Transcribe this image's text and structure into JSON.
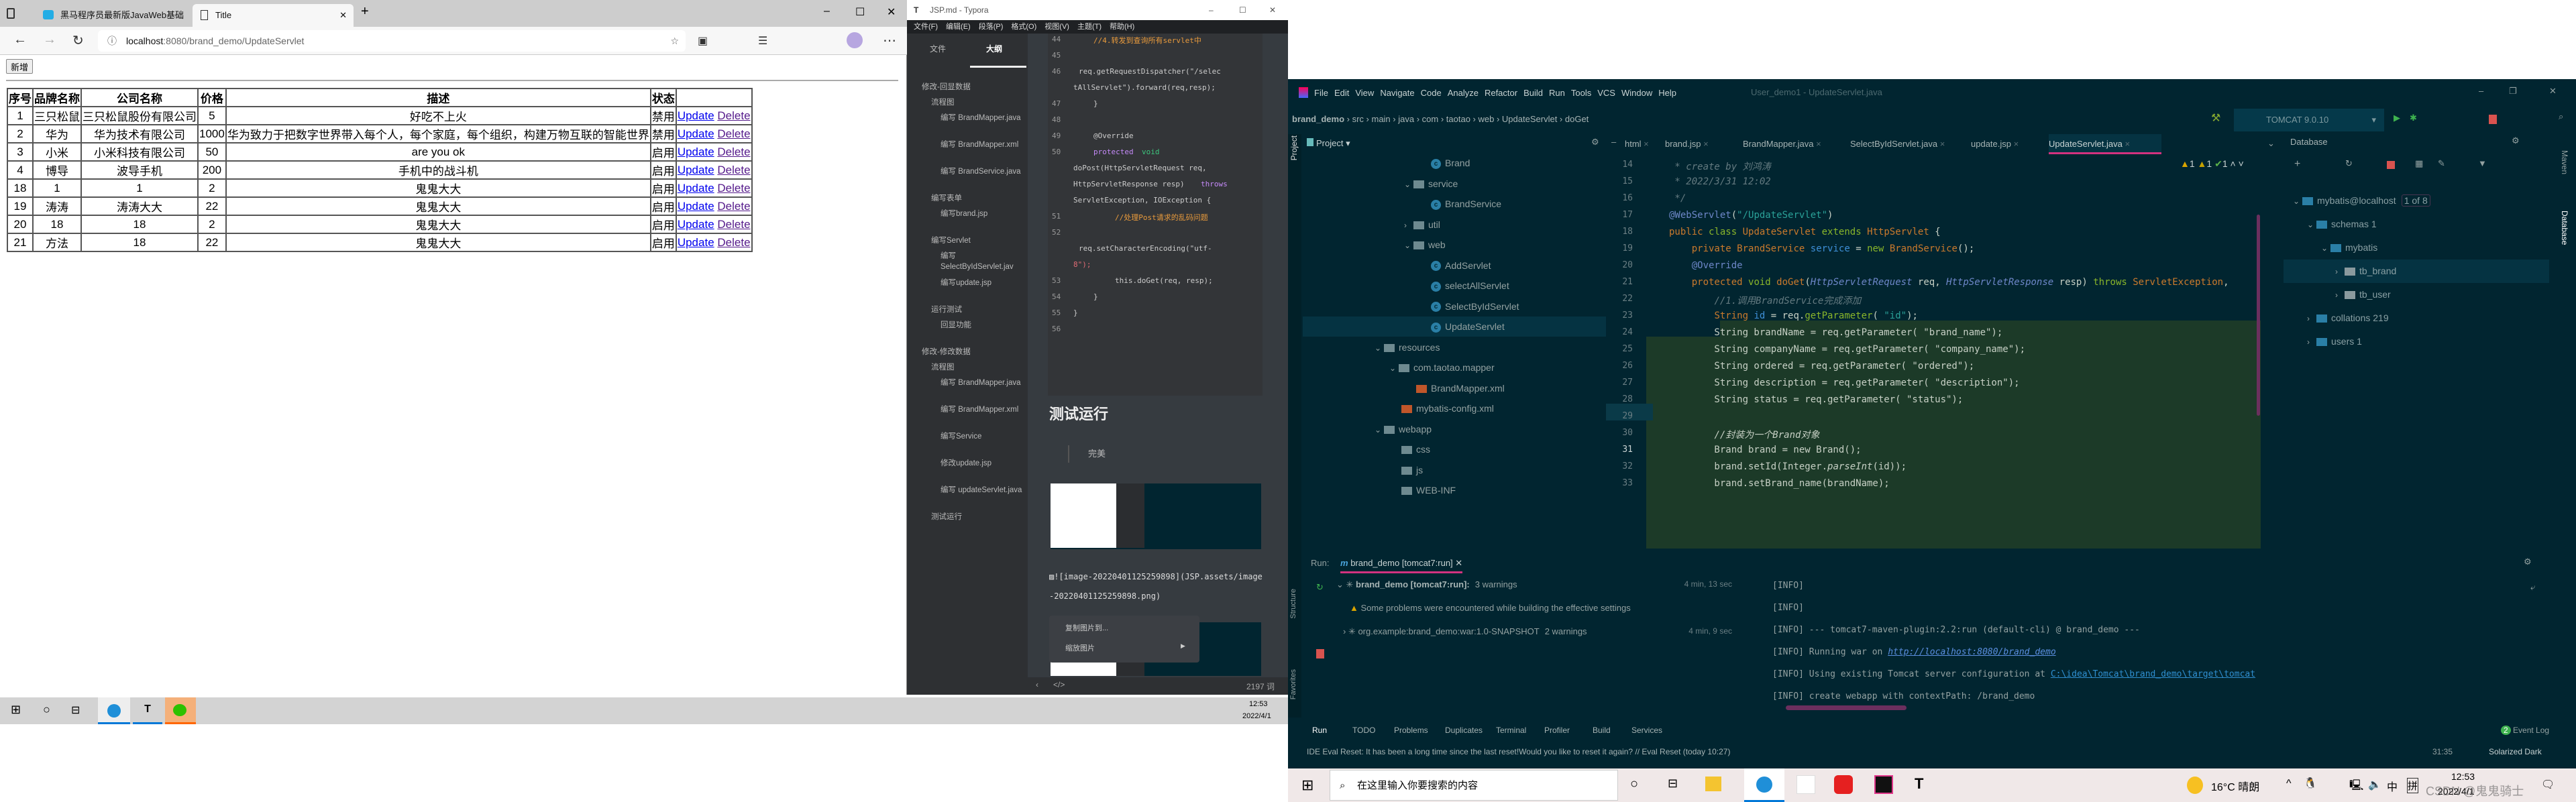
{
  "browser": {
    "tabs": [
      {
        "label": "黑马程序员最新版JavaWeb基础"
      },
      {
        "label": "Title"
      }
    ],
    "url_host": "localhost",
    "url_path": ":8080/brand_demo/UpdateServlet",
    "new_button": "新增",
    "table": {
      "headers": [
        "序号",
        "品牌名称",
        "公司名称",
        "价格",
        "描述",
        "状态",
        ""
      ],
      "rows": [
        [
          "1",
          "三只松鼠",
          "三只松鼠股份有限公司",
          "5",
          "好吃不上火",
          "禁用"
        ],
        [
          "2",
          "华为",
          "华为技术有限公司",
          "1000",
          "华为致力于把数字世界带入每个人，每个家庭，每个组织，构建万物互联的智能世界",
          "禁用"
        ],
        [
          "3",
          "小米",
          "小米科技有限公司",
          "50",
          "are you ok",
          "启用"
        ],
        [
          "4",
          "博导",
          "波导手机",
          "200",
          "手机中的战斗机",
          "启用"
        ],
        [
          "18",
          "1",
          "1",
          "2",
          "鬼鬼大大",
          "启用"
        ],
        [
          "19",
          "涛涛",
          "涛涛大大",
          "22",
          "鬼鬼大大",
          "启用"
        ],
        [
          "20",
          "18",
          "18",
          "2",
          "鬼鬼大大",
          "启用"
        ],
        [
          "21",
          "方法",
          "18",
          "22",
          "鬼鬼大大",
          "启用"
        ]
      ],
      "update_link": "Update",
      "delete_link": "Delete"
    }
  },
  "typora": {
    "title": "JSP.md - Typora",
    "menu": [
      "文件(F)",
      "编辑(E)",
      "段落(P)",
      "格式(O)",
      "视图(V)",
      "主题(T)",
      "帮助(H)"
    ],
    "side_tabs": [
      "文件",
      "大纲"
    ],
    "outline": [
      {
        "t": "修改-回显数据",
        "l": 0
      },
      {
        "t": "流程图",
        "l": 1
      },
      {
        "t": "编写 BrandMapper.java",
        "l": 2
      },
      {
        "t": "编写 BrandMapper.xml",
        "l": 2
      },
      {
        "t": "编写 BrandService.java",
        "l": 2
      },
      {
        "t": "编写表单",
        "l": 1
      },
      {
        "t": "编写brand.jsp",
        "l": 2
      },
      {
        "t": "编写Servlet",
        "l": 1
      },
      {
        "t": "编写 SelectByIdServlet.jav",
        "l": 2
      },
      {
        "t": "编写update.jsp",
        "l": 2
      },
      {
        "t": "运行测试",
        "l": 1
      },
      {
        "t": "回显功能",
        "l": 2
      },
      {
        "t": "修改-修改数据",
        "l": 0
      },
      {
        "t": "流程图",
        "l": 1
      },
      {
        "t": "编写 BrandMapper.java",
        "l": 2
      },
      {
        "t": "编写 BrandMapper.xml",
        "l": 2
      },
      {
        "t": "编写Service",
        "l": 2
      },
      {
        "t": "修改update.jsp",
        "l": 2
      },
      {
        "t": "编写 updateServlet.java",
        "l": 2
      },
      {
        "t": "测试运行",
        "l": 1
      }
    ],
    "code_lines": [
      "44",
      "45",
      "46",
      "",
      "47",
      "48",
      "49",
      "50",
      "",
      "",
      "",
      "51",
      "52",
      "",
      "",
      "53",
      "54",
      "55",
      "56"
    ],
    "code": {
      "c45": "//4.转发到查询所有servlet中",
      "c46a": "req.getRequestDispatcher(\"/selec",
      "c46b": "tAllServlet\").forward(req,resp);",
      "c47": "}",
      "c49": "@Override",
      "c50a": "protected",
      "c50b": "void",
      "c50c": "doPost(HttpServletRequest req,",
      "c50d": "HttpServletResponse resp)",
      "c50e": "throws",
      "c50f": "ServletException, IOException {",
      "c51": "//处理Post请求的乱码问题",
      "c52a": "req.setCharacterEncoding(\"utf-",
      "c52b": "8\");",
      "c53": "this.doGet(req, resp);",
      "c54": "}",
      "c55": "}"
    },
    "heading": "测试运行",
    "quote": "完美",
    "md_text": "![image-20220401125259898](JSP.assets/image-20220401125259898.png)",
    "context_menu": [
      "复制图片到...",
      "缩放图片"
    ],
    "word_count": "2197 词"
  },
  "taskbar_left": {
    "time": "12:53",
    "date": "2022/4/1"
  },
  "idea": {
    "menu": [
      "File",
      "Edit",
      "View",
      "Navigate",
      "Code",
      "Analyze",
      "Refactor",
      "Build",
      "Run",
      "Tools",
      "VCS",
      "Window",
      "Help"
    ],
    "window_title": "User_demo1 - UpdateServlet.java",
    "breadcrumb": [
      "brand_demo",
      "src",
      "main",
      "java",
      "com",
      "taotao",
      "web",
      "UpdateServlet",
      "doGet"
    ],
    "run_config": "TOMCAT 9.0.10",
    "project_label": "Project",
    "editor_tabs": [
      "html",
      "brand.jsp",
      "BrandMapper.java",
      "SelectByIdServlet.java",
      "update.jsp",
      "UpdateServlet.java"
    ],
    "tree": [
      {
        "t": "Brand",
        "i": "class",
        "d": 4
      },
      {
        "t": "service",
        "i": "folder",
        "d": 3,
        "c": "v"
      },
      {
        "t": "BrandService",
        "i": "class",
        "d": 4
      },
      {
        "t": "util",
        "i": "folder",
        "d": 3,
        "c": ">"
      },
      {
        "t": "web",
        "i": "folder",
        "d": 3,
        "c": "v"
      },
      {
        "t": "AddServlet",
        "i": "class",
        "d": 4
      },
      {
        "t": "selectAllServlet",
        "i": "class",
        "d": 4
      },
      {
        "t": "SelectByIdServlet",
        "i": "class",
        "d": 4
      },
      {
        "t": "UpdateServlet",
        "i": "class",
        "d": 4,
        "sel": true
      },
      {
        "t": "resources",
        "i": "folder",
        "d": 1,
        "c": "v"
      },
      {
        "t": "com.taotao.mapper",
        "i": "folder",
        "d": 2,
        "c": "v"
      },
      {
        "t": "BrandMapper.xml",
        "i": "xml",
        "d": 3
      },
      {
        "t": "mybatis-config.xml",
        "i": "xml",
        "d": 2
      },
      {
        "t": "webapp",
        "i": "folder",
        "d": 1,
        "c": "v"
      },
      {
        "t": "css",
        "i": "folder",
        "d": 2
      },
      {
        "t": "js",
        "i": "folder",
        "d": 2
      },
      {
        "t": "WEB-INF",
        "i": "folder",
        "d": 2
      }
    ],
    "inspections": {
      "warnings": "1",
      "weak": "1",
      "ok": "1"
    },
    "line_numbers": [
      "14",
      "15",
      "16",
      "17",
      "18",
      "19",
      "20",
      "21",
      "22",
      "23",
      "24",
      "25",
      "26",
      "27",
      "28",
      "29",
      "30",
      "31",
      "32",
      "33"
    ],
    "database": {
      "title": "Database",
      "items": [
        {
          "t": "mybatis@localhost",
          "badge": "1 of 8",
          "d": 0,
          "c": "v"
        },
        {
          "t": "schemas  1",
          "d": 1,
          "c": "v"
        },
        {
          "t": "mybatis",
          "d": 2,
          "c": "v"
        },
        {
          "t": "tb_brand",
          "d": 3,
          "c": ">",
          "sel": true
        },
        {
          "t": "tb_user",
          "d": 3,
          "c": ">"
        },
        {
          "t": "collations  219",
          "d": 1,
          "c": ">"
        },
        {
          "t": "users  1",
          "d": 1,
          "c": ">"
        }
      ]
    },
    "side_labels": [
      "Maven",
      "Database",
      "Structure",
      "Favorites"
    ],
    "run": {
      "label": "Run:",
      "tab": "brand_demo [tomcat7:run]",
      "tree": [
        {
          "t": "brand_demo [tomcat7:run]:",
          "w": "3 warnings",
          "time": "4 min, 13 sec"
        },
        {
          "t": "Some problems were encountered while building the effective settings"
        },
        {
          "t": "org.example:brand_demo:war:1.0-SNAPSHOT",
          "w": "2 warnings",
          "time": "4 min, 9 sec"
        }
      ],
      "console": [
        "[INFO]",
        "[INFO]",
        "[INFO] --- tomcat7-maven-plugin:2.2:run (default-cli) @ brand_demo ---",
        "[INFO] Running war on ",
        "[INFO] Using existing Tomcat server configuration at ",
        "[INFO] create webapp with contextPath: /brand_demo"
      ],
      "console_link1": "http://localhost:8080/brand_demo",
      "console_link2": "C:\\idea\\Tomcat\\brand_demo\\target\\tomcat"
    },
    "bottom_tools": [
      "Run",
      "TODO",
      "Problems",
      "Duplicates",
      "Terminal",
      "Profiler",
      "Build",
      "Services"
    ],
    "event_log": "Event Log",
    "event_count": "2",
    "status": "IDE Eval Reset: It has been a long time since the last reset!Would you like to reset it again? // Eval Reset (today 10:27)",
    "position": "31:35",
    "theme": "Solarized Dark"
  },
  "taskbar_right": {
    "search_placeholder": "在这里输入你要搜索的内容",
    "weather": "16°C 晴朗",
    "ime1": "中",
    "ime2": "拼",
    "time": "12:53",
    "date": "2022/4/1",
    "watermark": "CSDN @鬼鬼骑士"
  }
}
